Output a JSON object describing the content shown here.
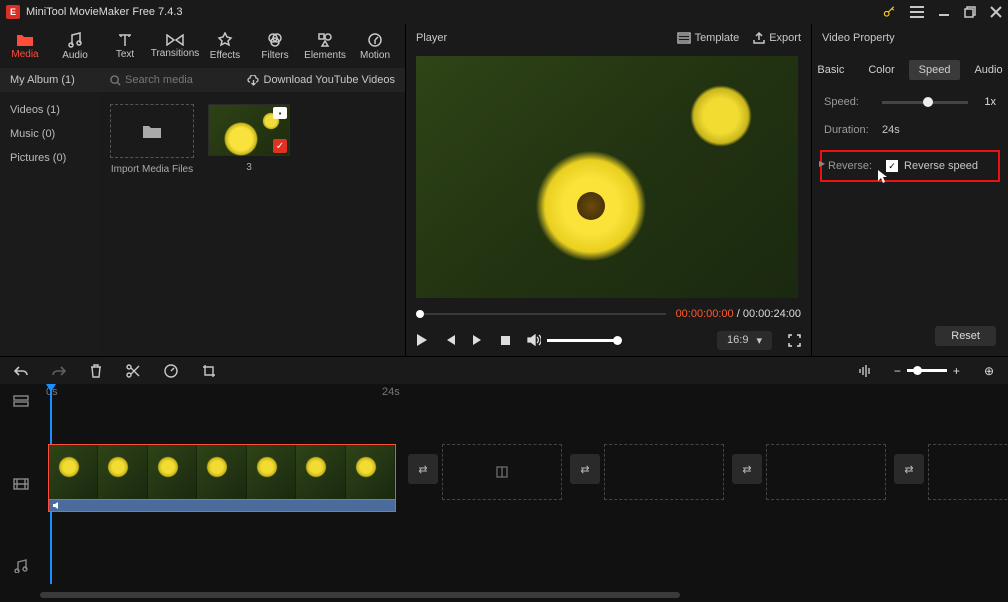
{
  "app": {
    "title": "MiniTool MovieMaker Free 7.4.3"
  },
  "toolbar": {
    "media": "Media",
    "audio": "Audio",
    "text": "Text",
    "transitions": "Transitions",
    "effects": "Effects",
    "filters": "Filters",
    "elements": "Elements",
    "motion": "Motion"
  },
  "subbar": {
    "album": "My Album (1)",
    "search_placeholder": "Search media",
    "download": "Download YouTube Videos"
  },
  "sidebar": {
    "items": [
      "Videos (1)",
      "Music (0)",
      "Pictures (0)"
    ]
  },
  "thumbs": {
    "import_label": "Import Media Files",
    "video_label": "3"
  },
  "player": {
    "title": "Player",
    "template": "Template",
    "export": "Export",
    "time_current": "00:00:00:00",
    "time_total": "00:00:24:00",
    "ratio": "16:9"
  },
  "props": {
    "title": "Video Property",
    "tabs": {
      "basic": "Basic",
      "color": "Color",
      "speed": "Speed",
      "audio": "Audio"
    },
    "speed_label": "Speed:",
    "speed_value": "1x",
    "duration_label": "Duration:",
    "duration_value": "24s",
    "reverse_label": "Reverse:",
    "reverse_option": "Reverse speed",
    "reset": "Reset"
  },
  "timeline": {
    "ruler": {
      "t0": "0s",
      "t24": "24s"
    }
  }
}
